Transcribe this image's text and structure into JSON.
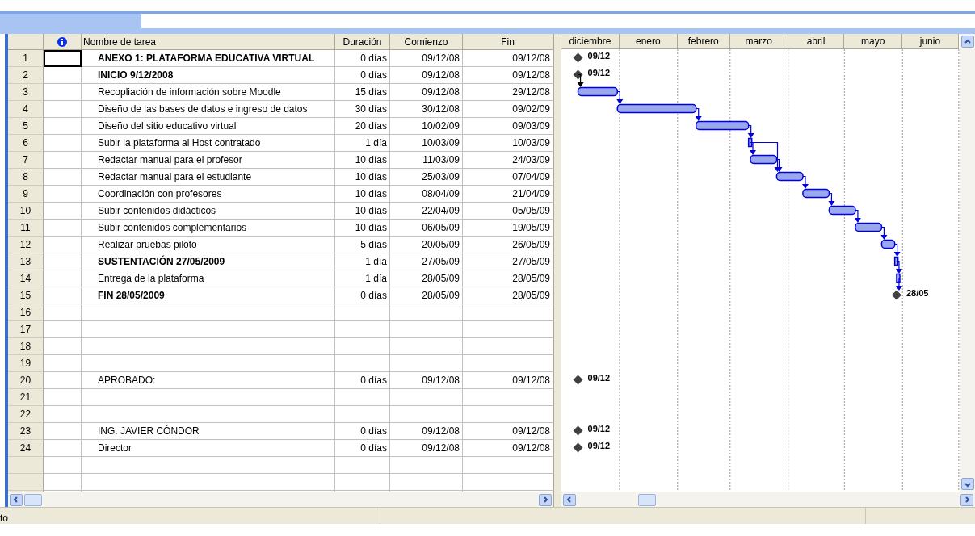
{
  "table": {
    "columns": [
      "Nombre de tarea",
      "Duración",
      "Comienzo",
      "Fin"
    ],
    "rows": [
      {
        "id": "1",
        "kind": "milestone",
        "name": "ANEXO 1: PLATAFORMA EDUCATIVA VIRTUAL",
        "bold": true,
        "selected": true,
        "duration": "0 días",
        "start": "09/12/08",
        "end": "09/12/08",
        "gantt_label": "09/12",
        "link_to_next": false,
        "link_skip": false
      },
      {
        "id": "2",
        "kind": "milestone",
        "name": "INICIO 9/12/2008",
        "bold": true,
        "selected": false,
        "duration": "0 días",
        "start": "09/12/08",
        "end": "09/12/08",
        "gantt_label": "09/12",
        "link_to_next": true,
        "link_skip": false
      },
      {
        "id": "3",
        "kind": "task",
        "name": "Recopliación de información sobre Moodle",
        "bold": false,
        "selected": false,
        "duration": "15 días",
        "start": "09/12/08",
        "end": "29/12/08",
        "link_to_next": true,
        "link_skip": false
      },
      {
        "id": "4",
        "kind": "task",
        "name": "Diseño de las bases de datos e ingreso de datos",
        "bold": false,
        "selected": false,
        "duration": "30 días",
        "start": "30/12/08",
        "end": "09/02/09",
        "link_to_next": true,
        "link_skip": false
      },
      {
        "id": "5",
        "kind": "task",
        "name": "Diseño del sitio educativo virtual",
        "bold": false,
        "selected": false,
        "duration": "20 días",
        "start": "10/02/09",
        "end": "09/03/09",
        "link_to_next": true,
        "link_skip": false
      },
      {
        "id": "6",
        "kind": "task",
        "name": "Subir la plataforma al Host contratado",
        "bold": false,
        "selected": false,
        "duration": "1 día",
        "start": "10/03/09",
        "end": "10/03/09",
        "link_to_next": true,
        "link_skip": true
      },
      {
        "id": "7",
        "kind": "task",
        "name": "Redactar manual para el profesor",
        "bold": false,
        "selected": false,
        "duration": "10 días",
        "start": "11/03/09",
        "end": "24/03/09",
        "link_to_next": true,
        "link_skip": false
      },
      {
        "id": "8",
        "kind": "task",
        "name": "Redactar manual para el estudiante",
        "bold": false,
        "selected": false,
        "duration": "10 días",
        "start": "25/03/09",
        "end": "07/04/09",
        "link_to_next": true,
        "link_skip": false
      },
      {
        "id": "9",
        "kind": "task",
        "name": "Coordinación con profesores",
        "bold": false,
        "selected": false,
        "duration": "10 días",
        "start": "08/04/09",
        "end": "21/04/09",
        "link_to_next": true,
        "link_skip": false
      },
      {
        "id": "10",
        "kind": "task",
        "name": "Subir contenidos didácticos",
        "bold": false,
        "selected": false,
        "duration": "10 días",
        "start": "22/04/09",
        "end": "05/05/09",
        "link_to_next": true,
        "link_skip": false
      },
      {
        "id": "11",
        "kind": "task",
        "name": "Subir contenidos complementarios",
        "bold": false,
        "selected": false,
        "duration": "10 días",
        "start": "06/05/09",
        "end": "19/05/09",
        "link_to_next": true,
        "link_skip": false
      },
      {
        "id": "12",
        "kind": "task",
        "name": "Realizar pruebas piloto",
        "bold": false,
        "selected": false,
        "duration": "5 días",
        "start": "20/05/09",
        "end": "26/05/09",
        "link_to_next": true,
        "link_skip": false
      },
      {
        "id": "13",
        "kind": "task",
        "name": "SUSTENTACIÓN 27/05/2009",
        "bold": true,
        "selected": false,
        "duration": "1 día",
        "start": "27/05/09",
        "end": "27/05/09",
        "link_to_next": true,
        "link_skip": false
      },
      {
        "id": "14",
        "kind": "task",
        "name": "Entrega de la plataforma",
        "bold": false,
        "selected": false,
        "duration": "1 día",
        "start": "28/05/09",
        "end": "28/05/09",
        "link_to_next": true,
        "link_skip": false
      },
      {
        "id": "15",
        "kind": "milestone",
        "name": "FIN 28/05/2009",
        "bold": true,
        "selected": false,
        "duration": "0 días",
        "start": "28/05/09",
        "end": "28/05/09",
        "gantt_label": "28/05",
        "link_to_next": false,
        "link_skip": false
      },
      {
        "id": "16",
        "kind": "blank",
        "selected": false
      },
      {
        "id": "17",
        "kind": "blank",
        "selected": false
      },
      {
        "id": "18",
        "kind": "blank",
        "selected": false
      },
      {
        "id": "19",
        "kind": "blank",
        "selected": false
      },
      {
        "id": "20",
        "kind": "milestone",
        "name": "APROBADO:",
        "bold": false,
        "selected": false,
        "duration": "0 días",
        "start": "09/12/08",
        "end": "09/12/08",
        "gantt_label": "09/12"
      },
      {
        "id": "21",
        "kind": "blank",
        "selected": false
      },
      {
        "id": "22",
        "kind": "blank",
        "selected": false
      },
      {
        "id": "23",
        "kind": "milestone",
        "name": "ING. JAVIER CÓNDOR",
        "bold": false,
        "selected": false,
        "duration": "0 días",
        "start": "09/12/08",
        "end": "09/12/08",
        "gantt_label": "09/12"
      },
      {
        "id": "24",
        "kind": "milestone",
        "name": "Director",
        "bold": false,
        "selected": false,
        "duration": "0 días",
        "start": "09/12/08",
        "end": "09/12/08",
        "gantt_label": "09/12"
      }
    ]
  },
  "gantt": {
    "months": [
      "diciembre",
      "enero",
      "febrero",
      "marzo",
      "abril",
      "mayo",
      "junio"
    ]
  },
  "status_bar": {
    "text": "to"
  }
}
